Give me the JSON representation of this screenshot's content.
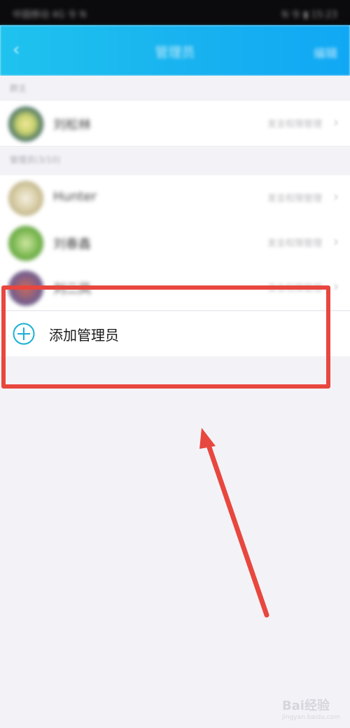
{
  "status_bar": {
    "left_text": "中国移动 4G 令 N",
    "right_text": "N 令 ▮ 15:23"
  },
  "nav": {
    "back_icon": "back-arrow-icon",
    "title": "管理员",
    "action": "编辑"
  },
  "sections": [
    {
      "header": "群主"
    },
    {
      "header": "管理员(3/10)"
    }
  ],
  "owner": {
    "name": "刘松林",
    "role": "发言权限管理"
  },
  "members": [
    {
      "name": "Hunter",
      "role": "发言权限管理"
    },
    {
      "name": "刘春鑫",
      "role": "发言权限管理"
    },
    {
      "name": "刘二凤",
      "role": "发言权限管理"
    }
  ],
  "add_admin": {
    "label": "添加管理员",
    "icon": "plus-circle-icon"
  },
  "colors": {
    "nav_blue": "#18b2f0",
    "highlight_red": "#e8473f",
    "plus_icon": "#1ab0d6"
  },
  "watermark": {
    "brand": "Bai经验",
    "url": "jingyan.baidu.com"
  }
}
